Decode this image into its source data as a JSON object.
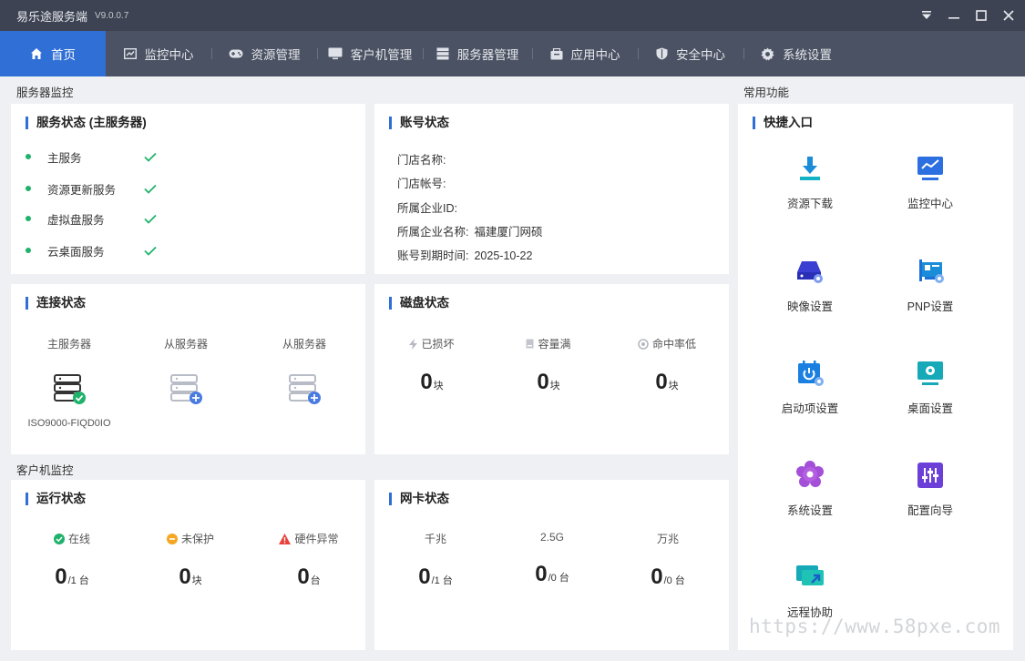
{
  "window": {
    "title": "易乐途服务端",
    "version": "V9.0.0.7"
  },
  "nav": {
    "items": [
      {
        "label": "首页",
        "icon": "home-icon",
        "active": true
      },
      {
        "label": "监控中心",
        "icon": "chart-icon"
      },
      {
        "label": "资源管理",
        "icon": "gamepad-icon"
      },
      {
        "label": "客户机管理",
        "icon": "monitor-icon"
      },
      {
        "label": "服务器管理",
        "icon": "server-icon"
      },
      {
        "label": "应用中心",
        "icon": "box-icon"
      },
      {
        "label": "安全中心",
        "icon": "shield-icon"
      },
      {
        "label": "系统设置",
        "icon": "gear-icon"
      }
    ]
  },
  "server_monitor": {
    "section_label": "服务器监控",
    "service_status": {
      "title": "服务状态 (主服务器)",
      "services": [
        {
          "name": "主服务"
        },
        {
          "name": "资源更新服务"
        },
        {
          "name": "虚拟盘服务"
        },
        {
          "name": "云桌面服务"
        }
      ]
    },
    "account_status": {
      "title": "账号状态",
      "rows": [
        {
          "label": "门店名称:",
          "value": ""
        },
        {
          "label": "门店帐号:",
          "value": ""
        },
        {
          "label": "所属企业ID:",
          "value": ""
        },
        {
          "label": "所属企业名称:",
          "value": "福建厦门网硕"
        },
        {
          "label": "账号到期时间:",
          "value": "2025-10-22"
        }
      ]
    },
    "connection_status": {
      "title": "连接状态",
      "servers": [
        {
          "label": "主服务器",
          "host": "ISO9000-FIQD0IO",
          "state": "connected"
        },
        {
          "label": "从服务器",
          "host": "",
          "state": "add"
        },
        {
          "label": "从服务器",
          "host": "",
          "state": "add"
        }
      ]
    },
    "disk_status": {
      "title": "磁盘状态",
      "stats": [
        {
          "label": "已损坏",
          "icon": "lightning-icon",
          "value": "0",
          "unit": "块"
        },
        {
          "label": "容量满",
          "icon": "disk-full-icon",
          "value": "0",
          "unit": "块"
        },
        {
          "label": "命中率低",
          "icon": "hit-rate-icon",
          "value": "0",
          "unit": "块"
        }
      ]
    }
  },
  "client_monitor": {
    "section_label": "客户机监控",
    "run_status": {
      "title": "运行状态",
      "stats": [
        {
          "label": "在线",
          "icon": "online-icon",
          "color": "#1fb26b",
          "value": "0",
          "unit": "/1 台"
        },
        {
          "label": "未保护",
          "icon": "unprotected-icon",
          "color": "#f5a623",
          "value": "0",
          "unit": "块"
        },
        {
          "label": "硬件异常",
          "icon": "warning-icon",
          "color": "#e8413c",
          "value": "0",
          "unit": "台"
        }
      ]
    },
    "nic_status": {
      "title": "网卡状态",
      "stats": [
        {
          "label": "千兆",
          "value": "0",
          "unit": "/1 台"
        },
        {
          "label": "2.5G",
          "value": "0",
          "unit": "/0 台"
        },
        {
          "label": "万兆",
          "value": "0",
          "unit": "/0 台"
        }
      ]
    }
  },
  "common_functions": {
    "section_label": "常用功能",
    "quick_entry": {
      "title": "快捷入口",
      "items": [
        {
          "label": "资源下载",
          "icon": "download-icon"
        },
        {
          "label": "监控中心",
          "icon": "monitor-chart-icon"
        },
        {
          "label": "映像设置",
          "icon": "image-disk-icon"
        },
        {
          "label": "PNP设置",
          "icon": "pnp-card-icon"
        },
        {
          "label": "启动项设置",
          "icon": "power-calendar-icon"
        },
        {
          "label": "桌面设置",
          "icon": "desktop-gear-icon"
        },
        {
          "label": "系统设置",
          "icon": "flower-gear-icon"
        },
        {
          "label": "配置向导",
          "icon": "sliders-icon"
        },
        {
          "label": "远程协助",
          "icon": "remote-screen-icon"
        }
      ]
    }
  },
  "watermark": "https://www.58pxe.com",
  "colors": {
    "accent": "#2f6fd6",
    "titlebar": "#3d4352",
    "navbar": "#4b5263",
    "success": "#1fb26b"
  }
}
